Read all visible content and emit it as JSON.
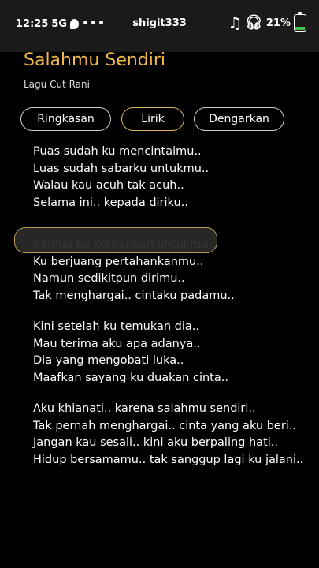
{
  "status_bar": {
    "time": "12:25",
    "network": "5G",
    "user": "shigit333",
    "battery": "21%",
    "battery_level": 0.21,
    "icons": [
      "chat-bubble-icon",
      "more-dots-icon",
      "music-note-icon",
      "headphone-icon",
      "battery-icon"
    ]
  },
  "song": {
    "title": "Salahmu Sendiri",
    "subtitle": "Lagu Cut Rani"
  },
  "tabs": [
    {
      "label": "Ringkasan"
    },
    {
      "label": "Lirik"
    },
    {
      "label": "Dengarkan"
    }
  ],
  "lyrics": [
    [
      "Puas sudah ku mencintaimu..",
      "Luas sudah sabarku untukmu..",
      "Walau kau acuh tak acuh..",
      "Selama ini.. kepada diriku.."
    ],
    [
      "Semua ku korbankan untukmu..",
      "Ku berjuang pertahankanmu..",
      "Namun sedikitpun dirimu..",
      "Tak menghargai.. cintaku padamu.."
    ],
    [
      "Kini setelah ku temukan dia..",
      "Mau terima aku apa adanya..",
      "Dia yang mengobati luka..",
      "Maafkan sayang ku duakan cinta.."
    ],
    [
      "Aku khianati.. karena salahmu sendiri..",
      "Tak pernah menghargai.. cinta yang aku beri..",
      "Jangan kau sesali.. kini aku berpaling hati..",
      "Hidup bersamamu.. tak sanggup lagi ku jalani.."
    ]
  ],
  "colors": {
    "accent": "#f0b84c",
    "background": "#000000",
    "popup_border": "#c9a34c"
  }
}
